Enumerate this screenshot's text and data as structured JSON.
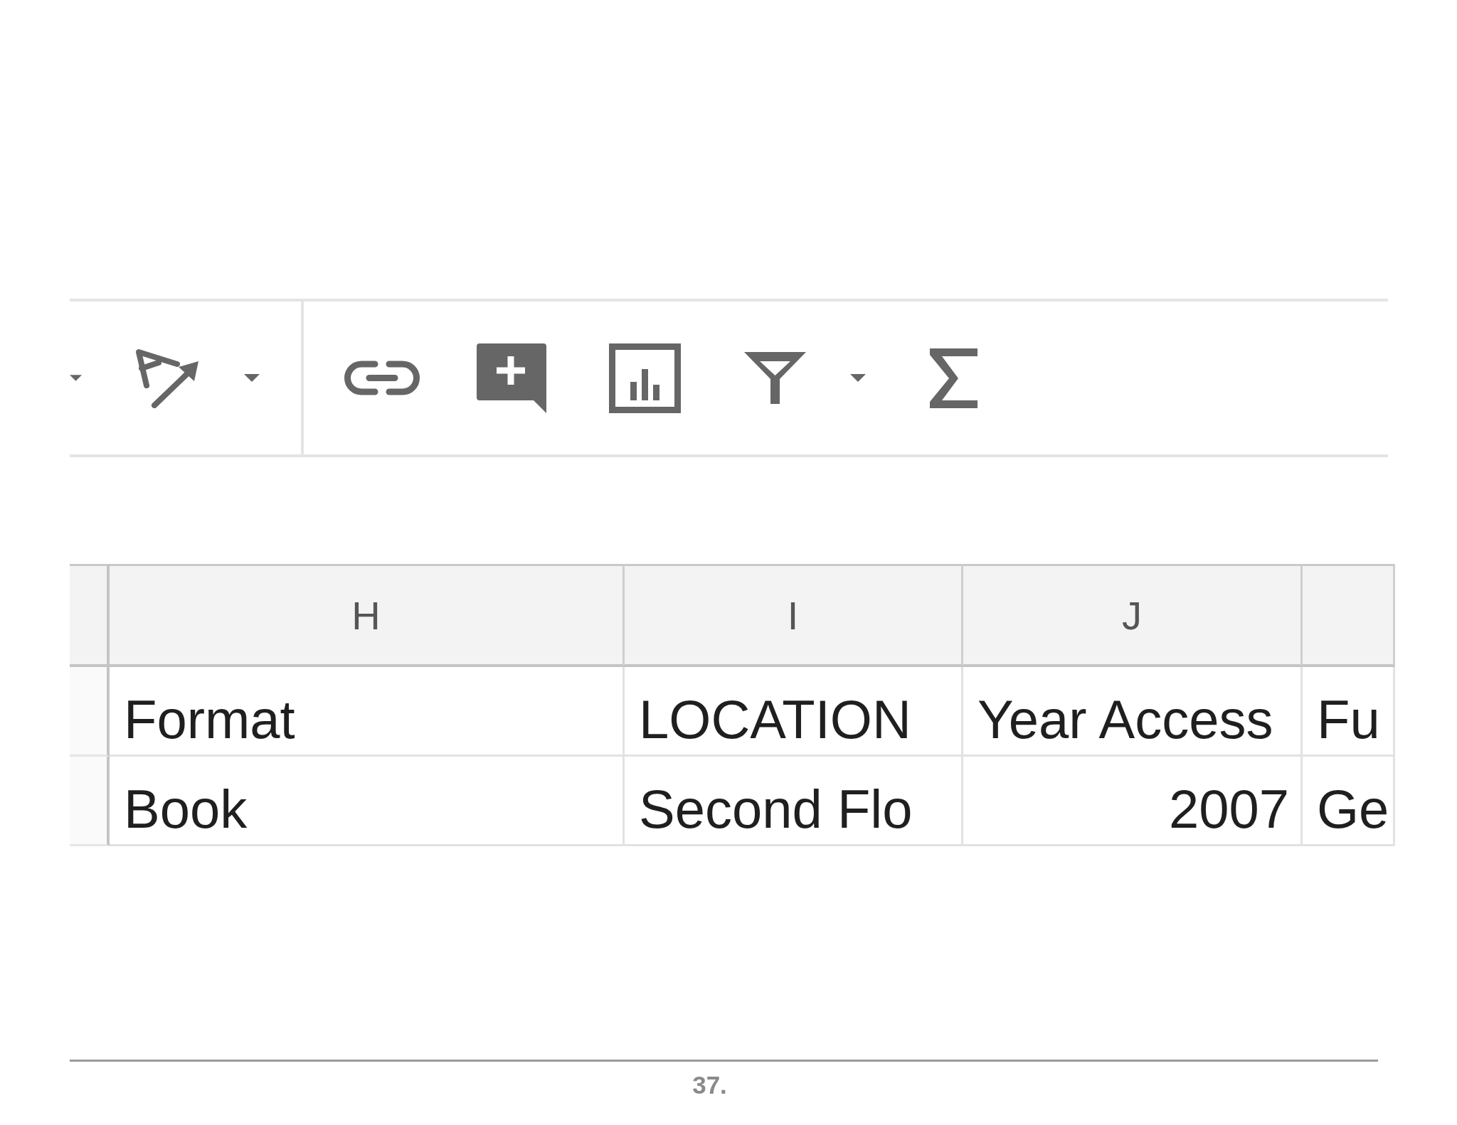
{
  "screenshot": {
    "toolbar": {
      "items": [
        {
          "kind": "caret"
        },
        {
          "kind": "text_rotation"
        },
        {
          "kind": "caret"
        },
        {
          "kind": "separator"
        },
        {
          "kind": "link"
        },
        {
          "kind": "comment"
        },
        {
          "kind": "chart"
        },
        {
          "kind": "filter"
        },
        {
          "kind": "caret"
        },
        {
          "kind": "function"
        }
      ]
    },
    "sheet": {
      "columns": [
        "H",
        "I",
        "J"
      ],
      "rows": [
        [
          {
            "text": "Format",
            "kind": "text"
          },
          {
            "text": "LOCATION",
            "kind": "text"
          },
          {
            "text": "Year Access",
            "kind": "text"
          },
          {
            "text": "Fu",
            "kind": "text"
          }
        ],
        [
          {
            "text": "Book",
            "kind": "text"
          },
          {
            "text": "Second Flo",
            "kind": "text"
          },
          {
            "text": "2007",
            "kind": "number"
          },
          {
            "text": "Ge",
            "kind": "text"
          }
        ]
      ]
    }
  },
  "footer": {
    "page_number": "37."
  }
}
